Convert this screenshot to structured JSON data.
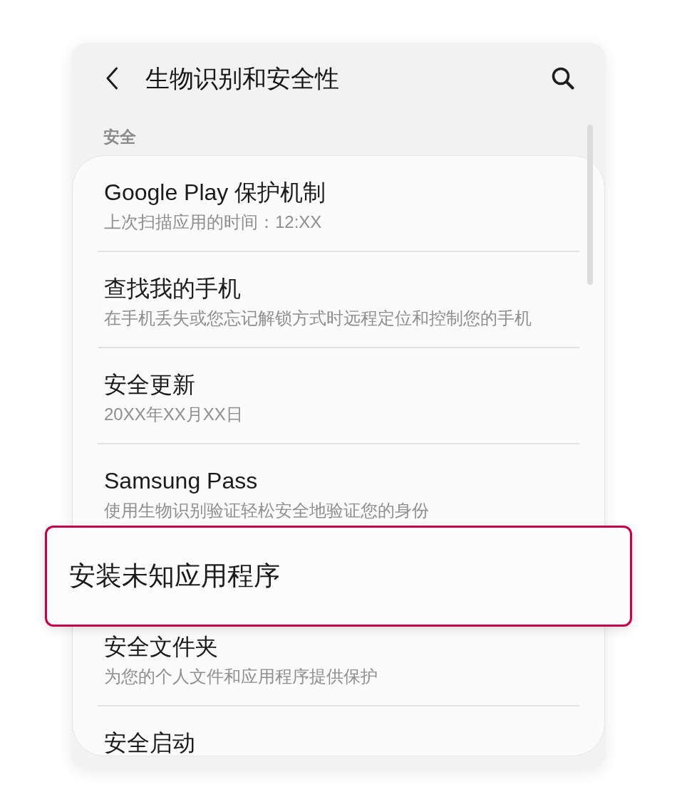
{
  "header": {
    "title": "生物识别和安全性"
  },
  "section": {
    "label": "安全"
  },
  "items": [
    {
      "title": "Google Play 保护机制",
      "subtitle": "上次扫描应用的时间：12:XX",
      "highlighted": false
    },
    {
      "title": "查找我的手机",
      "subtitle": "在手机丢失或您忘记解锁方式时远程定位和控制您的手机",
      "highlighted": false
    },
    {
      "title": "安全更新",
      "subtitle": "20XX年XX月XX日",
      "highlighted": false
    },
    {
      "title": "Samsung Pass",
      "subtitle": "使用生物识别验证轻松安全地验证您的身份",
      "highlighted": false
    },
    {
      "title": "安装未知应用程序",
      "highlighted": true
    },
    {
      "title": "安全文件夹",
      "subtitle": "为您的个人文件和应用程序提供保护",
      "highlighted": false
    },
    {
      "title": "安全启动",
      "highlighted": false
    }
  ]
}
